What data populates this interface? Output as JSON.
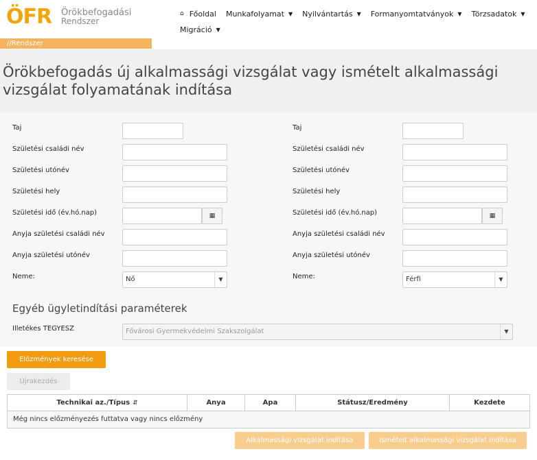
{
  "app": {
    "logo_mark": "ÖFR",
    "logo_line1": "Örökbefogadási",
    "logo_line2": "Rendszer"
  },
  "nav": {
    "row1": [
      {
        "label": "Főoldal",
        "icon": "home-icon",
        "has_caret": false
      },
      {
        "label": "Munkafolyamat",
        "has_caret": true
      },
      {
        "label": "Nyilvántartás",
        "has_caret": true
      },
      {
        "label": "Formanyomtatványok",
        "has_caret": true
      },
      {
        "label": "Törzsadatok",
        "has_caret": true
      }
    ],
    "row2": [
      {
        "label": "Migráció",
        "has_caret": true
      }
    ]
  },
  "breadcrumb": "//Rendszer",
  "page_title": "Örökbefogadás új alkalmassági vizsgálat vagy ismételt alkalmassági vizsgálat folyamatának indítása",
  "form": {
    "left": {
      "taj": {
        "label": "Taj",
        "value": ""
      },
      "birth_family_name": {
        "label": "Születési családi név",
        "value": ""
      },
      "birth_given_name": {
        "label": "Születési utónév",
        "value": ""
      },
      "birth_place": {
        "label": "Születési hely",
        "value": ""
      },
      "birth_date": {
        "label": "Születési idő (év.hó.nap)",
        "value": ""
      },
      "mother_family_name": {
        "label": "Anyja születési családi név",
        "value": ""
      },
      "mother_given_name": {
        "label": "Anyja születési utónév",
        "value": ""
      },
      "gender": {
        "label": "Neme:",
        "value": "Nő"
      }
    },
    "right": {
      "taj": {
        "label": "Taj",
        "value": ""
      },
      "birth_family_name": {
        "label": "Születési családi név",
        "value": ""
      },
      "birth_given_name": {
        "label": "Születési utónév",
        "value": ""
      },
      "birth_place": {
        "label": "Születési hely",
        "value": ""
      },
      "birth_date": {
        "label": "Születési idő (év.hó.nap)",
        "value": ""
      },
      "mother_family_name": {
        "label": "Anyja születési családi név",
        "value": ""
      },
      "mother_given_name": {
        "label": "Anyja születési utónév",
        "value": ""
      },
      "gender": {
        "label": "Neme:",
        "value": "Férfi"
      }
    },
    "other_section_title": "Egyéb ügyletindítási paraméterek",
    "tegyesz": {
      "label": "Illetékes TEGYESZ",
      "value": "Fővárosi Gyermekvédelmi Szakszolgálat"
    }
  },
  "buttons": {
    "search_history": "Előzmények keresése",
    "restart": "Újrakezdés",
    "start_new": "Alkalmassági vizsgálat indítása",
    "start_repeat": "Ismételt alkalmassági vizsgálat indítása"
  },
  "table": {
    "columns": [
      "Technikai az./Típus",
      "Anya",
      "Apa",
      "Státusz/Eredmény",
      "Kezdete"
    ],
    "empty_message": "Még nincs előzményezés futtatva vagy nincs előzmény"
  },
  "colors": {
    "accent": "#f29a12",
    "logo": "#f2a50d",
    "breadcrumb_bg": "#f5b35e",
    "disabled_action": "#f9cd8e"
  }
}
